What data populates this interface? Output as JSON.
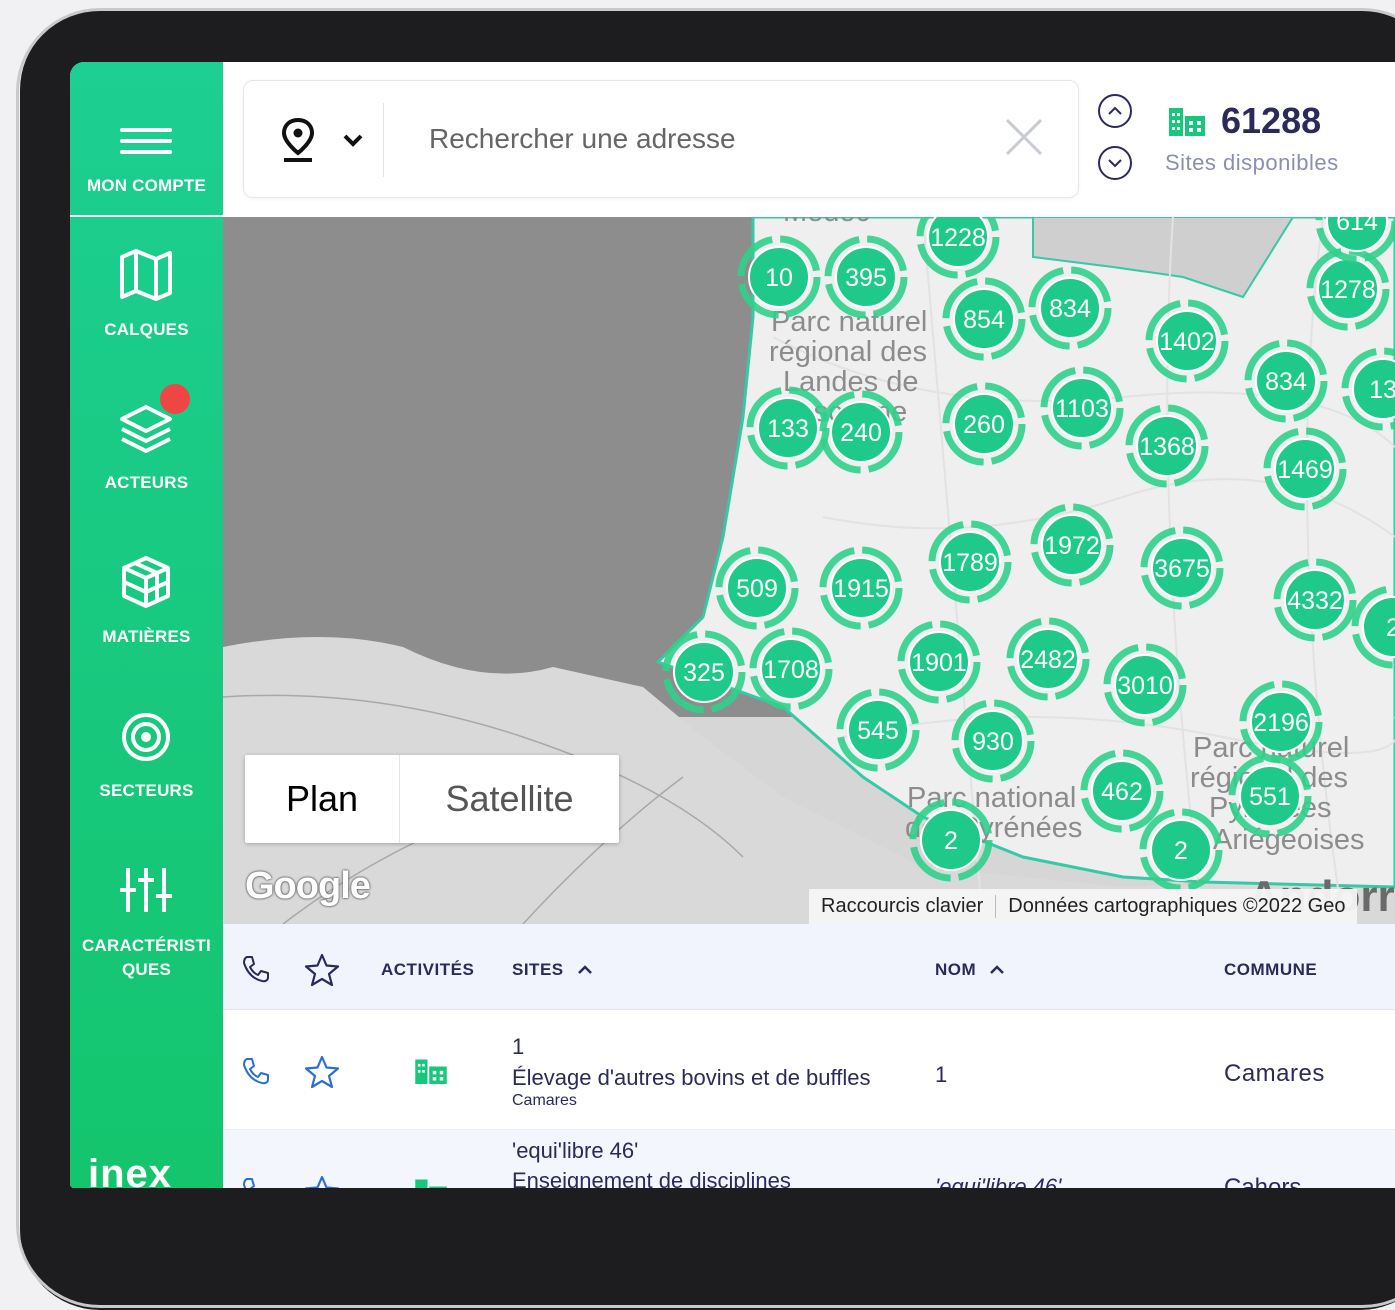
{
  "sidebar": {
    "menu_label": "MON COMPTE",
    "items": [
      {
        "label": "CALQUES",
        "icon": "map-icon"
      },
      {
        "label": "ACTEURS",
        "icon": "layers-icon"
      },
      {
        "label": "MATIÈRES",
        "icon": "cube-icon"
      },
      {
        "label": "SECTEURS",
        "icon": "target-icon"
      },
      {
        "label": "CARACTÉRISTI QUES",
        "icon": "sliders-icon"
      }
    ],
    "brand": "inex"
  },
  "search": {
    "placeholder": "Rechercher une adresse"
  },
  "counter": {
    "value": "61288",
    "label": "Sites disponibles"
  },
  "map": {
    "labels": [
      "Parc naturel",
      "régional des",
      "Landes de",
      "Gascogne",
      "Parc national",
      "des Pyrénées",
      "Parc naturel",
      "régional des",
      "Pyrénées",
      "Ariégeoises",
      "Andorre",
      "Médoc"
    ],
    "clusters": [
      "1228",
      "10",
      "395",
      "854",
      "834",
      "1402",
      "1278",
      "614",
      "834",
      "133",
      "240",
      "260",
      "1103",
      "1368",
      "1469",
      "13",
      "509",
      "1915",
      "1789",
      "1972",
      "3675",
      "4332",
      "2",
      "325",
      "1708",
      "1901",
      "2482",
      "3010",
      "2196",
      "545",
      "930",
      "462",
      "551",
      "2",
      "2"
    ],
    "toggle": {
      "plan": "Plan",
      "satellite": "Satellite"
    },
    "google": "Google",
    "shortcuts": "Raccourcis clavier",
    "data_attrib": "Données cartographiques ©2022 Geo"
  },
  "table": {
    "headers": {
      "activites": "ACTIVITÉS",
      "sites": "SITES",
      "nom": "NOM",
      "commune": "COMMUNE"
    },
    "rows": [
      {
        "site_name": "1",
        "site_activity": "Élevage d'autres bovins et de buffles",
        "site_commune": "Camares",
        "nom": "1",
        "commune": "Camares"
      },
      {
        "site_name": "'equi'libre 46'",
        "site_activity": "Enseignement de disciplines",
        "site_commune": "",
        "nom": "'equi'libre 46'",
        "commune": "Cahors"
      }
    ]
  },
  "colors": {
    "accent": "#17c87c",
    "navy": "#2b2a5a",
    "badge": "#f04545",
    "link_blue": "#2a6fd6"
  }
}
